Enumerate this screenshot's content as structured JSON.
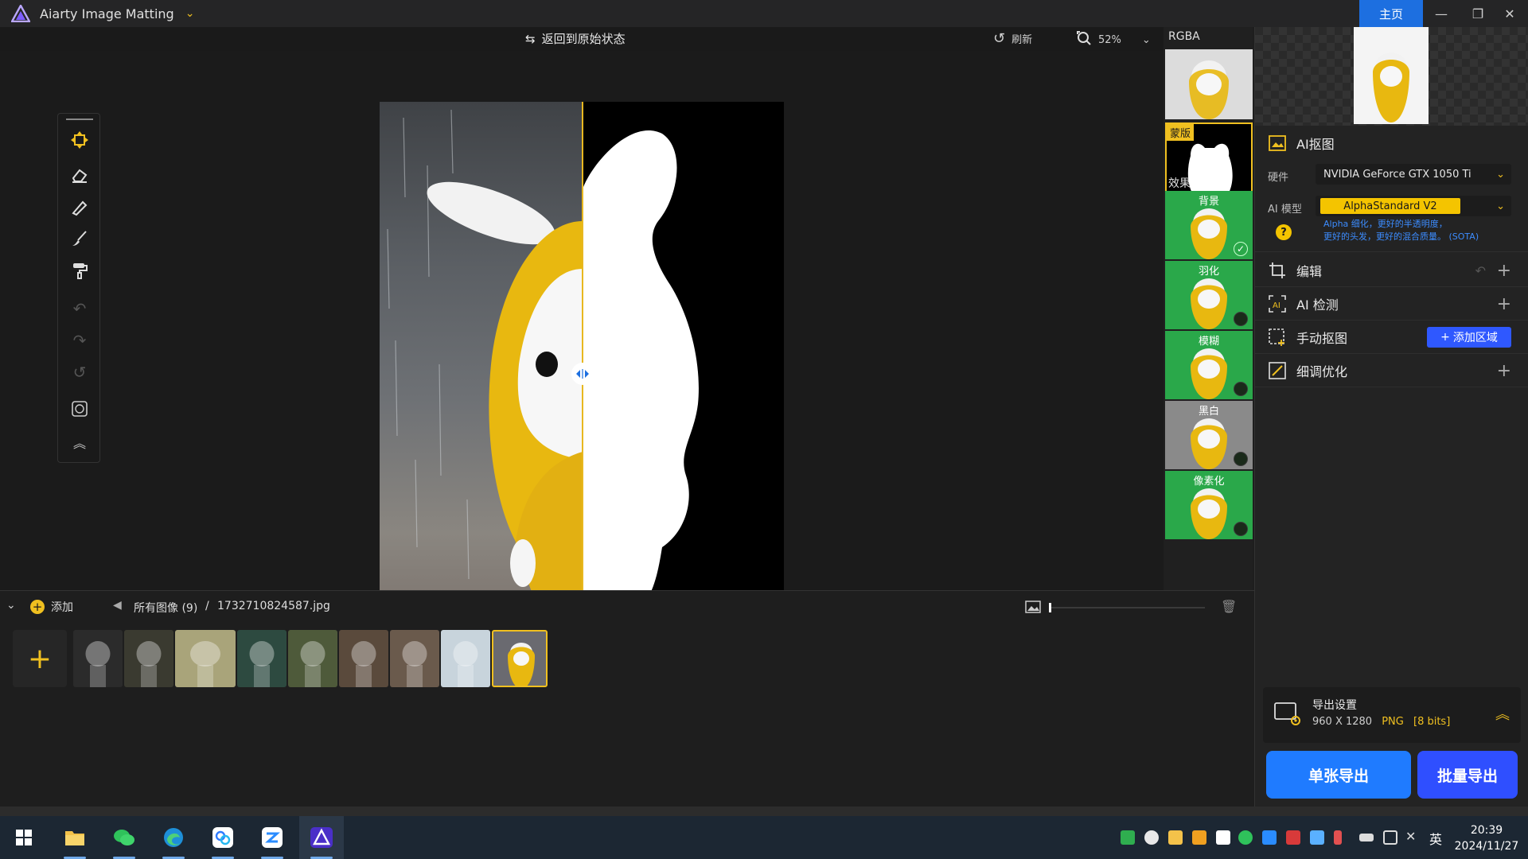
{
  "titlebar": {
    "app_name": "Aiarty Image Matting",
    "home_label": "主页"
  },
  "canvas_toolbar": {
    "restore_label": "返回到原始状态",
    "refresh_label": "刷新",
    "zoom_value": "52%"
  },
  "thumb_column": {
    "rgba_label": "RGBA",
    "mask_label": "蒙版",
    "effects_label": "效果",
    "effects": [
      {
        "label": "背景",
        "selected": true
      },
      {
        "label": "羽化",
        "selected": false
      },
      {
        "label": "模糊",
        "selected": false
      },
      {
        "label": "黑白",
        "selected": false
      },
      {
        "label": "像素化",
        "selected": false
      }
    ]
  },
  "right_panel": {
    "ai_matting_title": "AI抠图",
    "hardware_label": "硬件",
    "hardware_value": "NVIDIA GeForce GTX 1050 Ti",
    "model_label": "AI 模型",
    "model_value": "AlphaStandard  V2",
    "model_desc_line1": "Alpha 细化，更好的半透明度，",
    "model_desc_line2": "更好的头发，更好的混合质量。 (SOTA)",
    "help_glyph": "?",
    "sections": {
      "edit": "编辑",
      "ai_detect": "AI 检测",
      "manual_matting": "手动抠图",
      "refine": "细调优化"
    },
    "add_region_label": "添加区域",
    "export_settings_title": "导出设置",
    "export_size": "960 X 1280",
    "export_format": "PNG",
    "export_bits": "[8 bits]",
    "single_export": "单张导出",
    "batch_export": "批量导出"
  },
  "filmstrip": {
    "add_label": "添加",
    "all_images": "所有图像 (9)",
    "separator": "/",
    "current_file": "1732710824587.jpg",
    "thumbnails": [
      {
        "name": "jellyfish",
        "selected": false,
        "color": "#2b2b2b"
      },
      {
        "name": "tree-bark",
        "selected": false,
        "color": "#3a3a30"
      },
      {
        "name": "bicycle",
        "selected": false,
        "color": "#a9a47a"
      },
      {
        "name": "woman-red-dress",
        "selected": false,
        "color": "#2d4a40"
      },
      {
        "name": "woman-flowers",
        "selected": false,
        "color": "#4e5a3a"
      },
      {
        "name": "woman-portrait",
        "selected": false,
        "color": "#5a4a3c"
      },
      {
        "name": "woman-floral",
        "selected": false,
        "color": "#6a5a4c"
      },
      {
        "name": "penguin",
        "selected": false,
        "color": "#c8d4dc"
      },
      {
        "name": "bunny-raincoat",
        "selected": true,
        "color": "#6a6a70"
      }
    ]
  },
  "taskbar": {
    "time": "20:39",
    "date": "2024/11/27",
    "ime": "英",
    "apps": [
      "windows-start-icon",
      "file-explorer-icon",
      "wechat-icon",
      "edge-icon",
      "baidu-netdisk-icon",
      "app-blue-icon",
      "aiarty-icon"
    ]
  },
  "colors": {
    "accent_yellow": "#f0c020",
    "accent_blue": "#1d6fe0",
    "export_blue": "#1f7bff",
    "batch_blue": "#2f4fff"
  }
}
